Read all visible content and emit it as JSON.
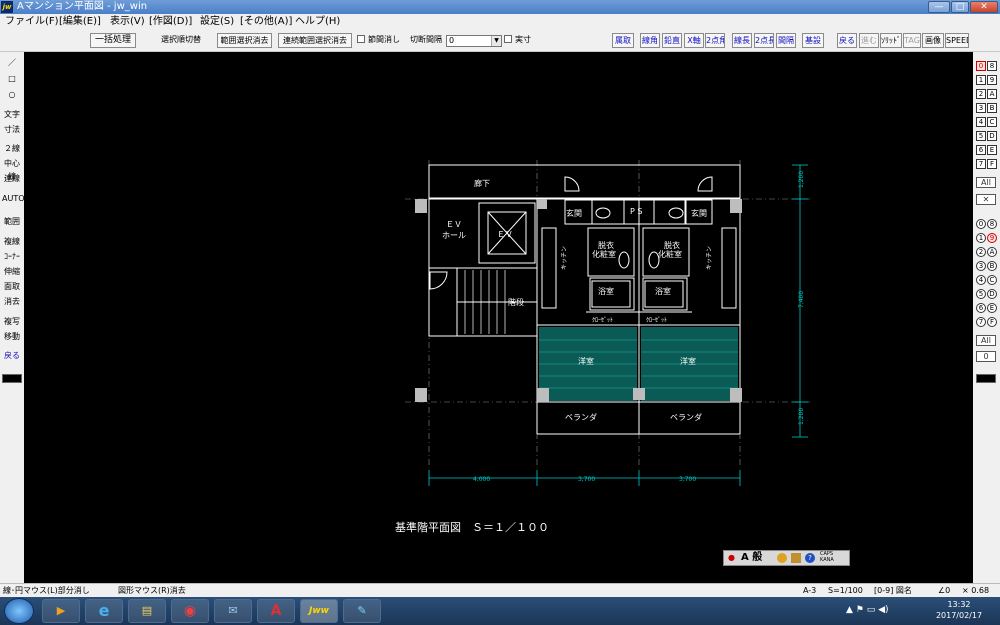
{
  "window": {
    "title": "Aマンション平面図 - jw_win",
    "app_icon": "jw",
    "min_label": "—",
    "max_label": "□",
    "close_label": "✕"
  },
  "menu": [
    "ファイル(F)",
    "[編集(E)]",
    "表示(V)",
    "[作図(D)]",
    "設定(S)",
    "[その他(A)]",
    "ヘルプ(H)"
  ],
  "toolbar": {
    "batch": "一括処理",
    "select_order": "選択順切替",
    "range_clear": "範囲選択消去",
    "cont_range_clear": "連続範囲選択消去",
    "node_clear": "節間消し",
    "cut_interval_label": "切断間隔",
    "cut_interval_value": "0",
    "actual_size": "実寸",
    "right_buttons": [
      "属取",
      "線角",
      "鉛直",
      "X軸",
      "2点角",
      "線長",
      "2点長",
      "間隔",
      "基設",
      "戻る",
      "進む",
      "ｿﾘｯﾄﾞ",
      "TAG",
      "画像",
      "SPEED"
    ]
  },
  "left_tools": [
    "／",
    "□",
    "○",
    "文字",
    "寸法",
    "２線",
    "中心線",
    "連線",
    "AUTO",
    "範囲",
    "複線",
    "ｺｰﾅｰ",
    "伸縮",
    "面取",
    "消去",
    "複写",
    "移動",
    "戻る"
  ],
  "right_layers": {
    "rows": [
      [
        "0",
        "8"
      ],
      [
        "1",
        "9"
      ],
      [
        "2",
        "A"
      ],
      [
        "3",
        "B"
      ],
      [
        "4",
        "C"
      ],
      [
        "5",
        "D"
      ],
      [
        "6",
        "E"
      ],
      [
        "7",
        "F"
      ]
    ],
    "all_label": "All",
    "cross_label": "✕",
    "group_rows": [
      [
        "0",
        "8"
      ],
      [
        "1",
        "9"
      ],
      [
        "2",
        "A"
      ],
      [
        "3",
        "B"
      ],
      [
        "4",
        "C"
      ],
      [
        "5",
        "D"
      ],
      [
        "6",
        "E"
      ],
      [
        "7",
        "F"
      ]
    ],
    "group_all": "All",
    "group_zero": "0"
  },
  "drawing": {
    "rooms": {
      "corridor": "廊下",
      "ev_hall_1": "ＥＶ",
      "ev_hall_2": "ホール",
      "ev": "ＥＶ",
      "stairs": "階段",
      "entrance_left": "玄関",
      "entrance_right": "玄関",
      "ps": "P S",
      "dressing_left_1": "脱衣",
      "dressing_left_2": "化粧室",
      "dressing_right_1": "脱衣",
      "dressing_right_2": "化粧室",
      "kitchen_left": "キッチン",
      "kitchen_right": "キッチン",
      "bath_left": "浴室",
      "bath_right": "浴室",
      "closet_left": "ｸﾛｰｾﾞｯﾄ",
      "closet_right": "ｸﾛｰｾﾞｯﾄ",
      "room_left": "洋室",
      "room_right": "洋室",
      "veranda_left": "ベランダ",
      "veranda_right": "ベランダ"
    },
    "dims": {
      "bottom": [
        "4,000",
        "3,700",
        "3,700"
      ],
      "right": [
        "1,200",
        "7,400",
        "1,200"
      ]
    },
    "caption": "基準階平面図　Ｓ＝１／１００"
  },
  "ime_bar": {
    "mode": "A 般",
    "caps": "CAPS",
    "kana": "KANA"
  },
  "status": {
    "left": "線･円マウス(L)部分消し",
    "mid": "図形マウス(R)消去",
    "paper": "A-3",
    "scale": "S=1/100",
    "layer": "[0-9] 図名",
    "angle": "∠0",
    "zoom": "× 0.68"
  },
  "taskbar": {
    "apps": [
      "windows-start",
      "media-player",
      "internet-explorer",
      "file-explorer",
      "chrome",
      "mail",
      "acrobat",
      "jw-cad",
      "paint"
    ],
    "tray": "▲ ⚑ ▭ ◀)",
    "time": "13:32",
    "date": "2017/02/17"
  },
  "colors": {
    "canvas_bg": "#000000",
    "wall": "#ffffff",
    "dim": "#00c8c8",
    "ime_red": "#cc0000"
  }
}
